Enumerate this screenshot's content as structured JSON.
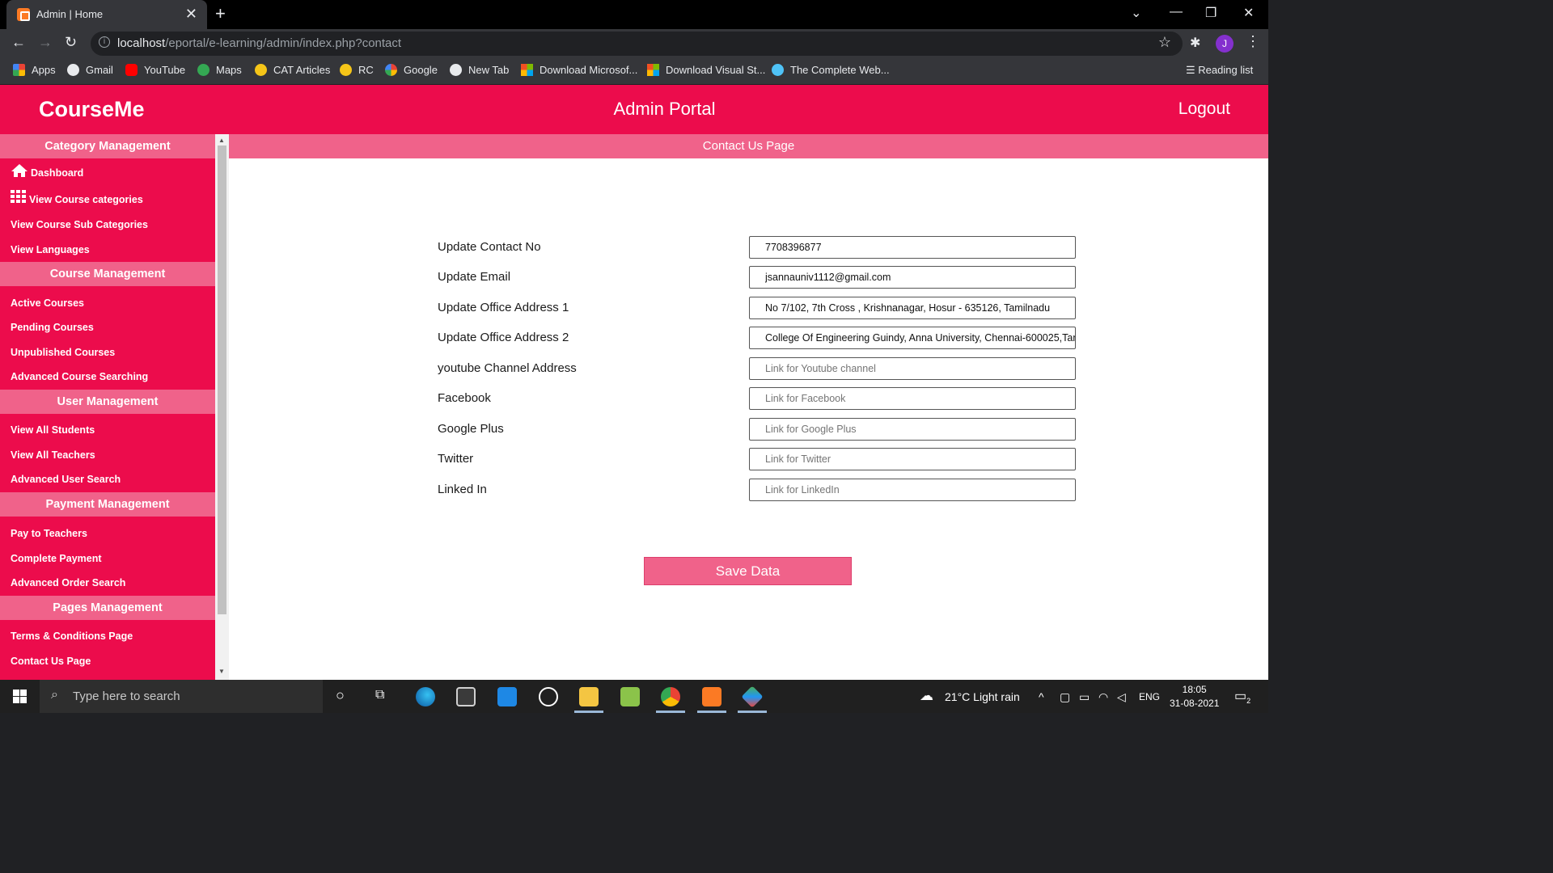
{
  "browser": {
    "tab_title": "Admin | Home",
    "url_host": "localhost",
    "url_path": "/eportal/e-learning/admin/index.php?contact",
    "avatar_letter": "J",
    "reading_list": "Reading list",
    "bookmarks": [
      "Apps",
      "Gmail",
      "YouTube",
      "Maps",
      "CAT Articles",
      "RC",
      "Google",
      "New Tab",
      "Download Microsof...",
      "Download Visual St...",
      "The Complete Web..."
    ]
  },
  "header": {
    "brand": "CourseMe",
    "title": "Admin Portal",
    "logout": "Logout"
  },
  "sidebar": {
    "sections": [
      {
        "title": "Category Management",
        "items": [
          "Dashboard",
          "View Course categories",
          "View Course Sub Categories",
          "View Languages"
        ]
      },
      {
        "title": "Course Management",
        "items": [
          "Active Courses",
          "Pending Courses",
          "Unpublished Courses",
          "Advanced Course Searching"
        ]
      },
      {
        "title": "User Management",
        "items": [
          "View All Students",
          "View All Teachers",
          "Advanced User Search"
        ]
      },
      {
        "title": "Payment Management",
        "items": [
          "Pay to Teachers",
          "Complete Payment",
          "Advanced Order Search"
        ]
      },
      {
        "title": "Pages Management",
        "items": [
          "Terms & Conditions Page",
          "Contact Us Page"
        ]
      }
    ]
  },
  "main": {
    "subtitle": "Contact Us Page",
    "fields": [
      {
        "label": "Update Contact No",
        "value": "7708396877",
        "placeholder": ""
      },
      {
        "label": "Update Email",
        "value": "jsannauniv1112@gmail.com",
        "placeholder": ""
      },
      {
        "label": "Update Office Address 1",
        "value": "No 7/102, 7th Cross , Krishnanagar, Hosur - 635126, Tamilnadu",
        "placeholder": ""
      },
      {
        "label": "Update Office Address 2",
        "value": "College Of Engineering Guindy, Anna University, Chennai-600025,Tam",
        "placeholder": ""
      },
      {
        "label": "youtube Channel Address",
        "value": "",
        "placeholder": "Link for Youtube channel"
      },
      {
        "label": "Facebook",
        "value": "",
        "placeholder": "Link for Facebook"
      },
      {
        "label": "Google Plus",
        "value": "",
        "placeholder": "Link for Google Plus"
      },
      {
        "label": "Twitter",
        "value": "",
        "placeholder": "Link for Twitter"
      },
      {
        "label": "Linked In",
        "value": "",
        "placeholder": "Link for LinkedIn"
      }
    ],
    "save_label": "Save Data"
  },
  "taskbar": {
    "search_placeholder": "Type here to search",
    "weather": "21°C  Light rain",
    "language": "ENG",
    "time": "18:05",
    "date": "31-08-2021",
    "notifications": "2"
  },
  "colors": {
    "brand_pink": "#ec0c4c",
    "light_pink": "#f0628a"
  }
}
